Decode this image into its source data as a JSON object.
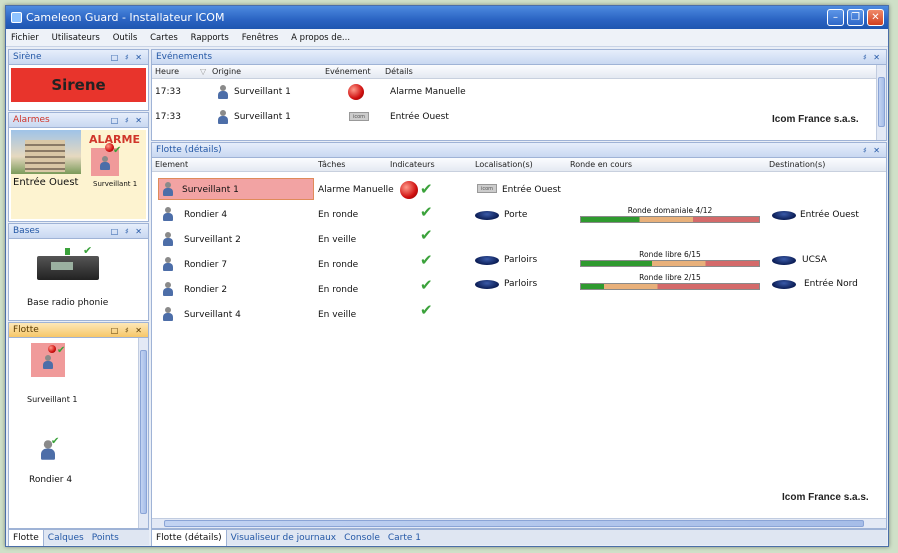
{
  "window": {
    "title": "Cameleon Guard - Installateur ICOM"
  },
  "menu": [
    "Fichier",
    "Utilisateurs",
    "Outils",
    "Cartes",
    "Rapports",
    "Fenêtres",
    "A propos de..."
  ],
  "sirene": {
    "title": "Sirène",
    "button": "Sirene"
  },
  "alarmes": {
    "title": "Alarmes",
    "alarm_label": "ALARME",
    "location": "Entrée Ouest",
    "person": "Surveillant 1"
  },
  "bases": {
    "title": "Bases",
    "item": "Base radio phonie"
  },
  "flotte_side": {
    "title": "Flotte",
    "items": [
      "Surveillant 1",
      "Rondier 4"
    ],
    "tabs": [
      "Flotte",
      "Calques",
      "Points"
    ]
  },
  "events": {
    "title": "Evénements",
    "columns": [
      "Heure",
      "Origine",
      "Evénement",
      "Détails"
    ],
    "rows": [
      {
        "time": "17:33",
        "origin": "Surveillant 1",
        "event_icon": "red-alarm",
        "details": "Alarme Manuelle"
      },
      {
        "time": "17:33",
        "origin": "Surveillant 1",
        "event_icon": "badge",
        "details": "Entrée Ouest"
      }
    ],
    "company": "Icom France s.a.s."
  },
  "fleet": {
    "title": "Flotte (détails)",
    "columns": [
      "Element",
      "Tâches",
      "Indicateurs",
      "Localisation(s)",
      "Ronde en cours",
      "Destination(s)"
    ],
    "rows": [
      {
        "element": "Surveillant 1",
        "task": "Alarme Manuelle",
        "alarm": true,
        "location": "Entrée Ouest",
        "loc_icon": "badge",
        "round": "",
        "destination": ""
      },
      {
        "element": "Rondier 4",
        "task": "En ronde",
        "alarm": false,
        "location": "Porte",
        "loc_icon": "reader",
        "round": "Ronde domaniale  4/12",
        "progress": 0.33,
        "destination": "Entrée Ouest"
      },
      {
        "element": "Surveillant 2",
        "task": "En veille",
        "alarm": false,
        "location": "",
        "round": "",
        "destination": ""
      },
      {
        "element": "Rondier 7",
        "task": "En ronde",
        "alarm": false,
        "location": "Parloirs",
        "loc_icon": "reader",
        "round": "Ronde libre 6/15",
        "progress": 0.4,
        "destination": "UCSA"
      },
      {
        "element": "Rondier 2",
        "task": "En ronde",
        "alarm": false,
        "location": "Parloirs",
        "loc_icon": "reader",
        "round": "Ronde libre 2/15",
        "progress": 0.13,
        "destination": "Entrée Nord"
      },
      {
        "element": "Surveillant 4",
        "task": "En veille",
        "alarm": false,
        "location": "",
        "round": "",
        "destination": ""
      }
    ],
    "company": "Icom France s.a.s.",
    "tabs": [
      "Flotte (détails)",
      "Visualiseur de journaux",
      "Console",
      "Carte 1"
    ]
  },
  "colors": {
    "title_bar": "#2a63c2",
    "sirene_red": "#e8342c",
    "selected_row": "#f2a3a3",
    "check_green": "#3ba23b"
  }
}
